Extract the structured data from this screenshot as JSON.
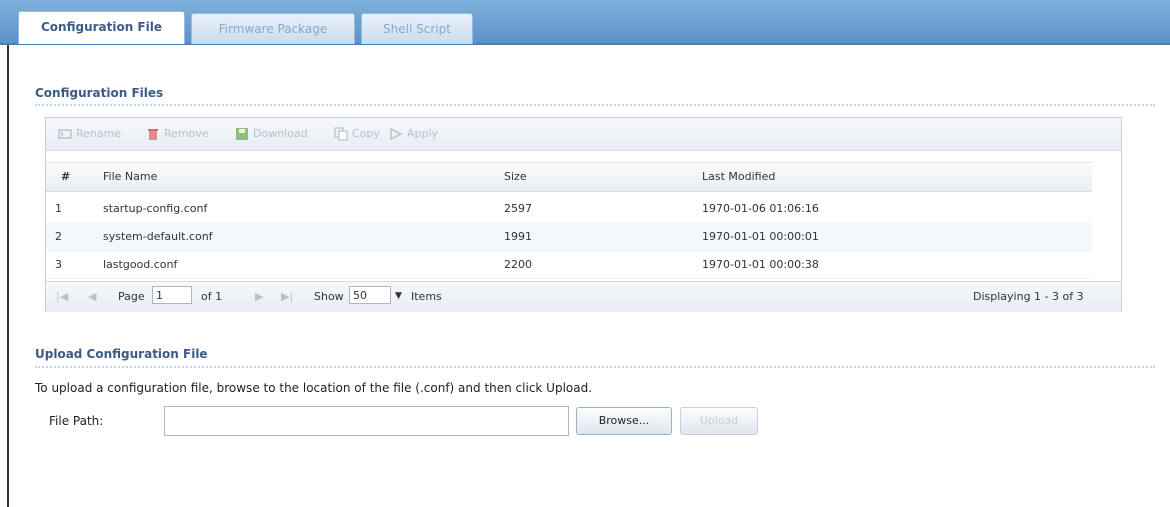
{
  "tabs": [
    {
      "label": "Configuration File",
      "active": true
    },
    {
      "label": "Firmware Package",
      "active": false
    },
    {
      "label": "Shell Script",
      "active": false
    }
  ],
  "section_config_files": "Configuration Files",
  "toolbar": {
    "rename": "Rename",
    "remove": "Remove",
    "download": "Download",
    "copy": "Copy",
    "apply": "Apply"
  },
  "table": {
    "headers": {
      "num": "#",
      "file_name": "File Name",
      "size": "Size",
      "last_modified": "Last Modified"
    },
    "rows": [
      {
        "num": "1",
        "file_name": "startup-config.conf",
        "size": "2597",
        "last_modified": "1970-01-06 01:06:16"
      },
      {
        "num": "2",
        "file_name": "system-default.conf",
        "size": "1991",
        "last_modified": "1970-01-01 00:00:01"
      },
      {
        "num": "3",
        "file_name": "lastgood.conf",
        "size": "2200",
        "last_modified": "1970-01-01 00:00:38"
      }
    ]
  },
  "pager": {
    "page_label": "Page",
    "page_value": "1",
    "of_label": "of 1",
    "show_label": "Show",
    "show_value": "50",
    "items_label": "Items",
    "displaying": "Displaying 1 - 3 of 3"
  },
  "section_upload": "Upload Configuration File",
  "upload": {
    "instructions": "To upload a configuration file, browse to the location of the file (.conf) and then click Upload.",
    "file_path_label": "File Path:",
    "file_path_value": "",
    "browse_label": "Browse...",
    "upload_label": "Upload"
  },
  "colors": {
    "accent": "#3b5a86",
    "tabbar": "#5d93c9"
  }
}
